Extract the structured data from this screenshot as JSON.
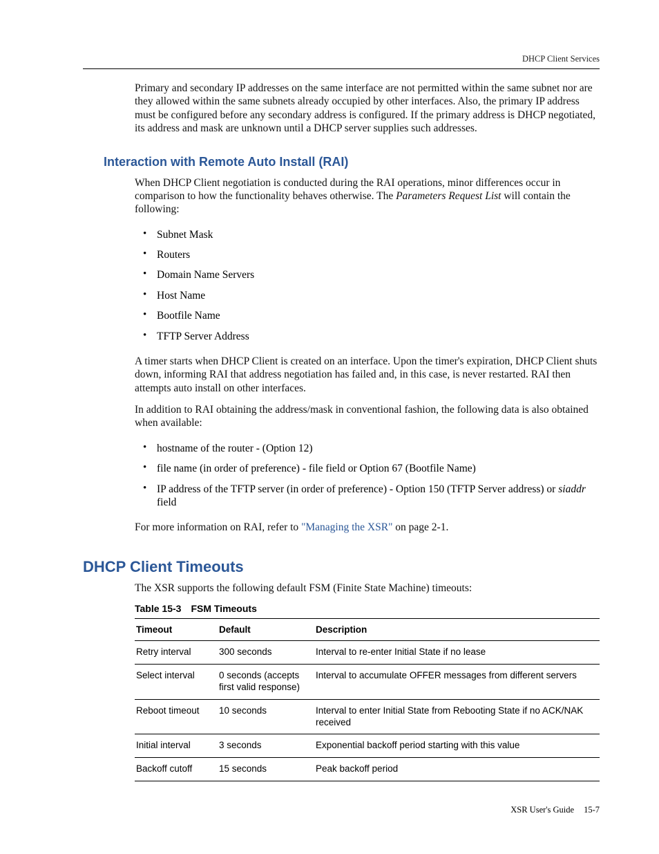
{
  "header": {
    "running": "DHCP Client Services"
  },
  "intro_para": "Primary and secondary IP addresses on the same interface are not permitted within the same subnet nor are they allowed within the same subnets already occupied by other interfaces. Also, the primary IP address must be configured before any secondary address is configured. If the primary address is DHCP negotiated, its address and mask are unknown until a DHCP server supplies such addresses.",
  "section_rai": {
    "title": "Interaction with Remote Auto Install (RAI)",
    "p1_a": "When DHCP Client negotiation is conducted during the RAI operations, minor differences occur in comparison to how the functionality behaves otherwise. The ",
    "p1_i": "Parameters Request List",
    "p1_b": " will contain the following:",
    "list1": [
      "Subnet Mask",
      "Routers",
      "Domain Name Servers",
      "Host Name",
      "Bootfile Name",
      "TFTP Server Address"
    ],
    "p2": "A timer starts when DHCP Client is created on an interface. Upon the timer's expiration, DHCP Client shuts down, informing RAI that address negotiation has failed and, in this case, is never restarted. RAI then attempts auto install on other interfaces.",
    "p3": "In addition to RAI obtaining the address/mask in conventional fashion, the following data is also obtained when available:",
    "list2_0": "hostname of the router - (Option 12)",
    "list2_1": "file name (in order of preference) - file field or Option 67 (Bootfile Name)",
    "list2_2a": "IP address of the TFTP server (in order of preference) - Option 150 (TFTP Server address) or ",
    "list2_2i": "siaddr",
    "list2_2b": " field",
    "p4_a": "For more information on RAI, refer to ",
    "p4_link": "\"Managing the XSR\"",
    "p4_b": " on page 2-1."
  },
  "section_timeouts": {
    "title": "DHCP Client Timeouts",
    "intro": "The XSR supports the following default FSM (Finite State Machine) timeouts:",
    "caption_num": "Table 15-3",
    "caption_title": "FSM Timeouts",
    "cols": [
      "Timeout",
      "Default",
      "Description"
    ],
    "rows": [
      {
        "t": "Retry interval",
        "d": "300 seconds",
        "desc": "Interval to re-enter Initial State if no lease"
      },
      {
        "t": "Select interval",
        "d": "0 seconds (accepts first valid response)",
        "desc": "Interval to accumulate OFFER messages from different servers"
      },
      {
        "t": "Reboot timeout",
        "d": "10 seconds",
        "desc": "Interval to enter Initial State from Rebooting State if no ACK/NAK received"
      },
      {
        "t": "Initial interval",
        "d": "3 seconds",
        "desc": "Exponential backoff period starting with this value"
      },
      {
        "t": "Backoff cutoff",
        "d": "15 seconds",
        "desc": "Peak backoff period"
      }
    ]
  },
  "footer": {
    "guide": "XSR User's Guide",
    "page": "15-7"
  }
}
